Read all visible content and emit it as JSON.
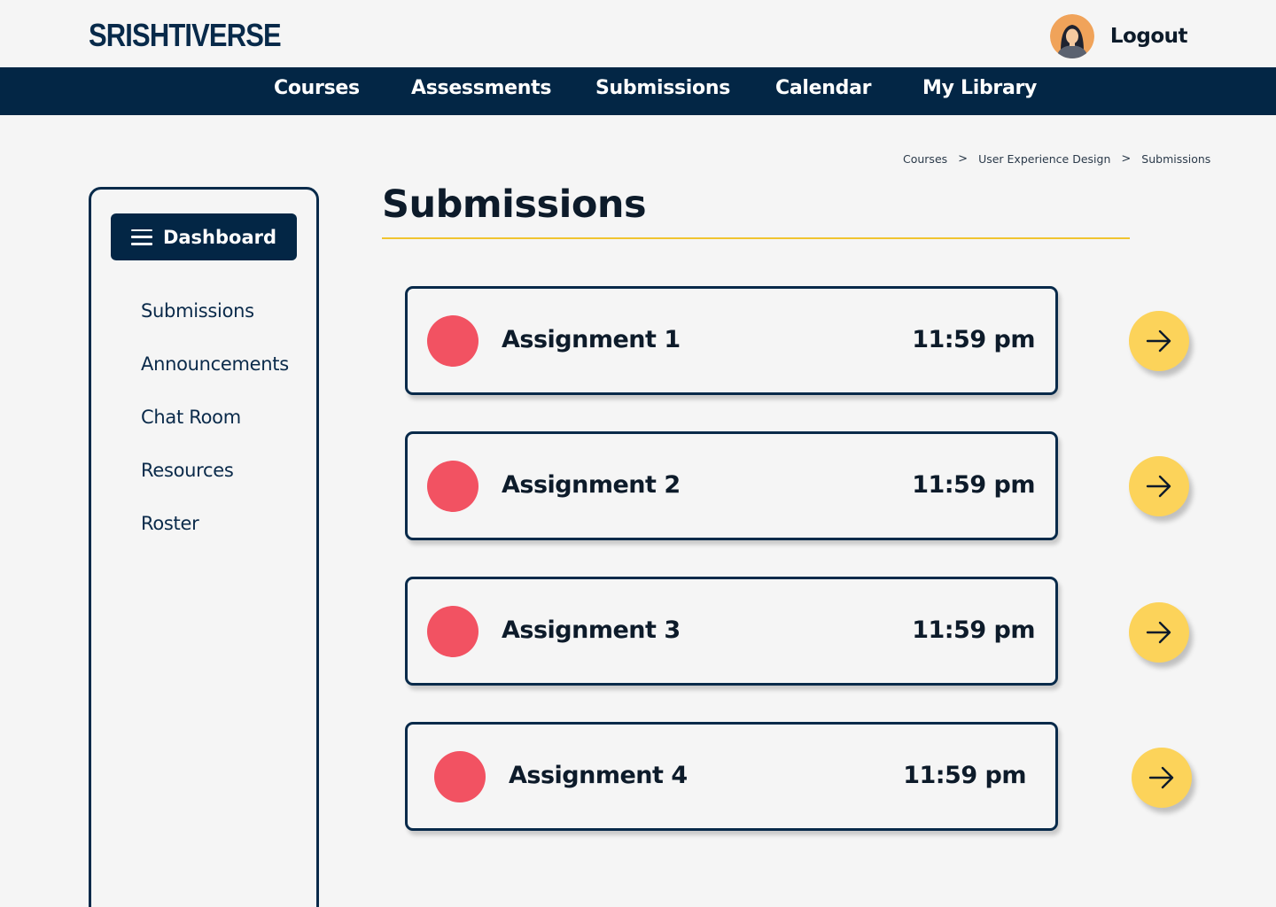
{
  "header": {
    "logo": "SRISHTIVERSE",
    "logout_label": "Logout",
    "avatar_icon": "user-avatar-icon"
  },
  "nav": {
    "items": [
      {
        "label": "Courses"
      },
      {
        "label": "Assessments"
      },
      {
        "label": "Submissions"
      },
      {
        "label": "Calendar"
      },
      {
        "label": "My Library"
      }
    ]
  },
  "breadcrumb": {
    "items": [
      "Courses",
      "User Experience Design",
      "Submissions"
    ],
    "separator": ">"
  },
  "sidebar": {
    "dashboard_label": "Dashboard",
    "items": [
      {
        "label": "Submissions"
      },
      {
        "label": "Announcements"
      },
      {
        "label": "Chat Room"
      },
      {
        "label": "Resources"
      },
      {
        "label": "Roster"
      }
    ]
  },
  "main": {
    "title": "Submissions",
    "assignments": [
      {
        "name": "Assignment 1",
        "time": "11:59 pm"
      },
      {
        "name": "Assignment 2",
        "time": "11:59 pm"
      },
      {
        "name": "Assignment 3",
        "time": "11:59 pm"
      },
      {
        "name": "Assignment 4",
        "time": "11:59 pm"
      }
    ]
  },
  "colors": {
    "navy": "#032645",
    "accent_yellow": "#fcd35a",
    "status_red": "#f25262",
    "rule_yellow": "#f0c430"
  }
}
